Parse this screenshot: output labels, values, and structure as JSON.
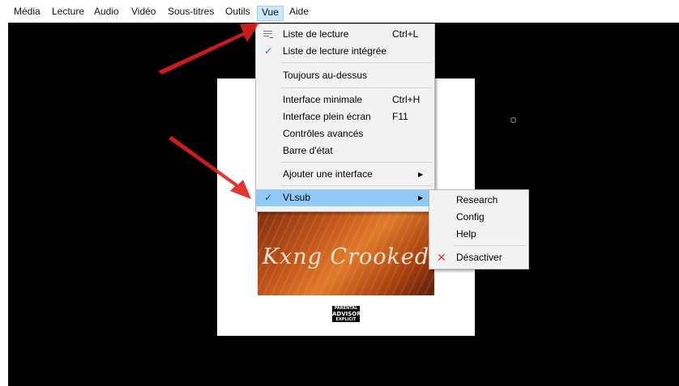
{
  "menubar": {
    "items": [
      "Média",
      "Lecture",
      "Audio",
      "Vidéo",
      "Sous-titres",
      "Outils",
      "Vue",
      "Aide"
    ]
  },
  "view_menu": {
    "playlist": {
      "label": "Liste de lecture",
      "shortcut": "Ctrl+L"
    },
    "docked_playlist": {
      "label": "Liste de lecture intégrée",
      "checked": true
    },
    "always_on_top": {
      "label": "Toujours au-dessus"
    },
    "minimal": {
      "label": "Interface minimale",
      "shortcut": "Ctrl+H"
    },
    "fullscreen": {
      "label": "Interface plein écran",
      "shortcut": "F11"
    },
    "advanced": {
      "label": "Contrôles avancés"
    },
    "statusbar": {
      "label": "Barre d'état"
    },
    "add_interface": {
      "label": "Ajouter une interface"
    },
    "vlsub": {
      "label": "VLsub",
      "checked": true
    }
  },
  "vlsub_menu": {
    "research": "Research",
    "config": "Config",
    "help": "Help",
    "deactivate": "Désactiver"
  },
  "artwork": {
    "title": "Kxng Crooked",
    "advisory": [
      "PARENTAL",
      "ADVISORY",
      "EXPLICIT CONTENT"
    ]
  },
  "colors": {
    "highlight": "#91c9f7",
    "menu_bg": "#f2f2f2",
    "active_menubar": "#cce8ff",
    "check": "#1f6fd1",
    "deactivate_x": "#d83333",
    "annotation_arrow": "#e0201e"
  },
  "icons": {
    "checkmark": "checkmark-icon",
    "playlist": "playlist-icon",
    "submenu_arrow": "chevron-right-icon",
    "deactivate": "close-icon"
  }
}
